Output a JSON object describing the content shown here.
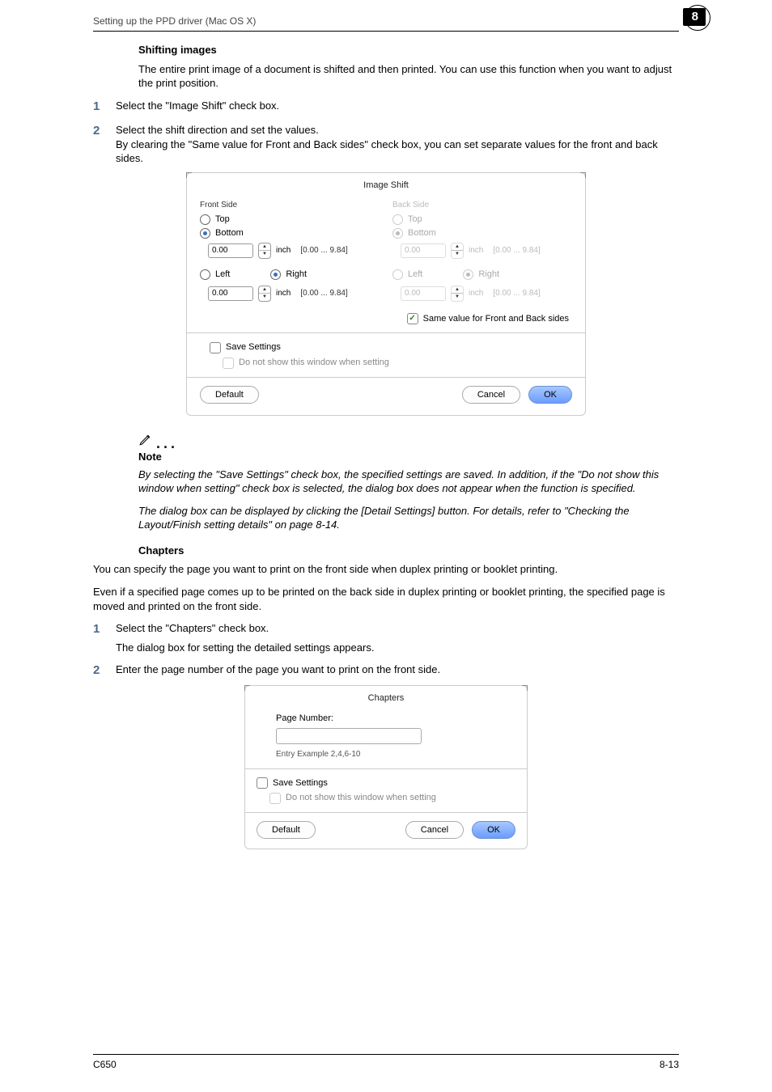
{
  "header": {
    "title": "Setting up the PPD driver (Mac OS X)",
    "chapter_badge": "8"
  },
  "shifting": {
    "heading": "Shifting images",
    "intro": "The entire print image of a document is shifted and then printed. You can use this function when you want to adjust the print position.",
    "step1": "Select the \"Image Shift\" check box.",
    "step2a": "Select the shift direction and set the values.",
    "step2b": "By clearing the \"Same value for Front and Back sides\" check box, you can set separate values for the front and back sides."
  },
  "image_shift_dialog": {
    "title": "Image Shift",
    "front_label": "Front Side",
    "back_label": "Back Side",
    "top": "Top",
    "bottom": "Bottom",
    "left": "Left",
    "right": "Right",
    "value": "0.00",
    "unit": "inch",
    "range": "[0.00 ... 9.84]",
    "same_value": "Same value for Front and Back sides",
    "save_settings": "Save Settings",
    "no_show": "Do not show this window when setting",
    "default": "Default",
    "cancel": "Cancel",
    "ok": "OK"
  },
  "note": {
    "label": "Note",
    "p1": "By selecting the \"Save Settings\" check box, the specified settings are saved. In addition, if the \"Do not show this window when setting\" check box is selected, the dialog box does not appear when the function is specified.",
    "p2": "The dialog box can be displayed by clicking the [Detail Settings] button. For details, refer to \"Checking the Layout/Finish setting details\" on page 8-14."
  },
  "chapters": {
    "heading": "Chapters",
    "p1": "You can specify the page you want to print on the front side when duplex printing or booklet printing.",
    "p2": "Even if a specified page comes up to be printed on the back side in duplex printing or booklet printing, the specified page is moved and printed on the front side.",
    "step1a": "Select the \"Chapters\" check box.",
    "step1b": "The dialog box for setting the detailed settings appears.",
    "step2": "Enter the page number of the page you want to print on the front side."
  },
  "chapters_dialog": {
    "title": "Chapters",
    "page_number_label": "Page Number:",
    "entry_example": "Entry Example 2,4,6-10",
    "save_settings": "Save Settings",
    "no_show": "Do not show this window when setting",
    "default": "Default",
    "cancel": "Cancel",
    "ok": "OK"
  },
  "footer": {
    "model": "C650",
    "page_no": "8-13"
  }
}
